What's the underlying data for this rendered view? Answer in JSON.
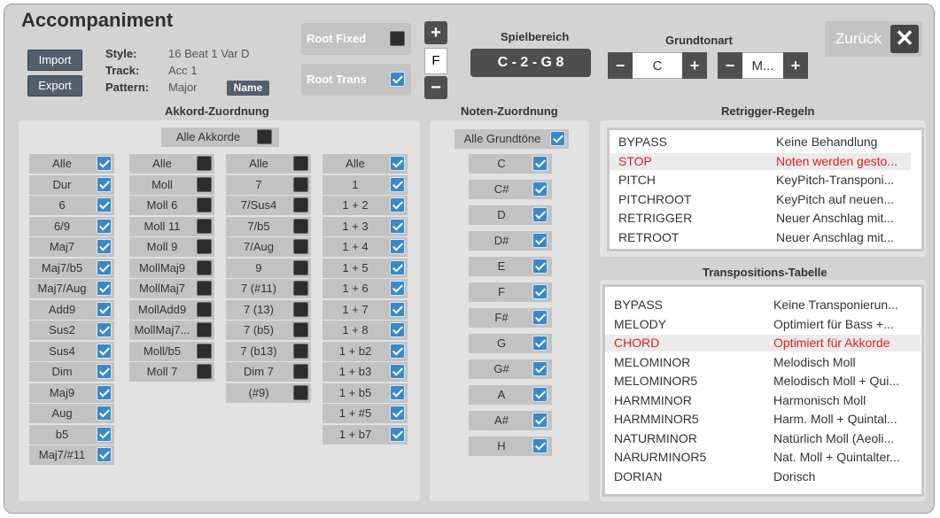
{
  "title": "Accompaniment",
  "buttons": {
    "import": "Import",
    "export": "Export",
    "name": "Name",
    "zurueck": "Zurück"
  },
  "info": {
    "style_label": "Style:",
    "style_value": "16 Beat 1 Var D",
    "track_label": "Track:",
    "track_value": "Acc 1",
    "pattern_label": "Pattern:",
    "pattern_value": "Major"
  },
  "root_fixed": {
    "label": "Root Fixed",
    "checked": false
  },
  "root_trans": {
    "label": "Root Trans",
    "checked": true
  },
  "octave": {
    "plus": "+",
    "value": "F",
    "minus": "−"
  },
  "spielbereich": {
    "title": "Spielbereich",
    "value": "C - 2 - G 8"
  },
  "grundtonart": {
    "title": "Grundtonart",
    "key_value": "C",
    "mode_value": "M..."
  },
  "akkord": {
    "title": "Akkord-Zuordnung",
    "all_label": "Alle Akkorde",
    "all_checked": false,
    "columns": [
      [
        {
          "l": "Alle",
          "c": true
        },
        {
          "l": "Dur",
          "c": true
        },
        {
          "l": "6",
          "c": true
        },
        {
          "l": "6/9",
          "c": true
        },
        {
          "l": "Maj7",
          "c": true
        },
        {
          "l": "Maj7/b5",
          "c": true
        },
        {
          "l": "Maj7/Aug",
          "c": true
        },
        {
          "l": "Add9",
          "c": true
        },
        {
          "l": "Sus2",
          "c": true
        },
        {
          "l": "Sus4",
          "c": true
        },
        {
          "l": "Dim",
          "c": true
        },
        {
          "l": "Maj9",
          "c": true
        },
        {
          "l": "Aug",
          "c": true
        },
        {
          "l": "b5",
          "c": true
        },
        {
          "l": "Maj7/#11",
          "c": true
        }
      ],
      [
        {
          "l": "Alle",
          "c": false
        },
        {
          "l": "Moll",
          "c": false
        },
        {
          "l": "Moll 6",
          "c": false
        },
        {
          "l": "Moll 11",
          "c": false
        },
        {
          "l": "Moll 9",
          "c": false
        },
        {
          "l": "MollMaj9",
          "c": false
        },
        {
          "l": "MollMaj7",
          "c": false
        },
        {
          "l": "MollAdd9",
          "c": false
        },
        {
          "l": "MollMaj7...",
          "c": false
        },
        {
          "l": "Moll/b5",
          "c": false
        },
        {
          "l": "Moll 7",
          "c": false
        }
      ],
      [
        {
          "l": "Alle",
          "c": false
        },
        {
          "l": "7",
          "c": false
        },
        {
          "l": "7/Sus4",
          "c": false
        },
        {
          "l": "7/b5",
          "c": false
        },
        {
          "l": "7/Aug",
          "c": false
        },
        {
          "l": "9",
          "c": false
        },
        {
          "l": "7 (#11)",
          "c": false
        },
        {
          "l": "7 (13)",
          "c": false
        },
        {
          "l": "7 (b5)",
          "c": false
        },
        {
          "l": "7 (b13)",
          "c": false
        },
        {
          "l": "Dim 7",
          "c": false
        },
        {
          "l": "(#9)",
          "c": false
        }
      ],
      [
        {
          "l": "Alle",
          "c": true
        },
        {
          "l": "1",
          "c": true
        },
        {
          "l": "1 + 2",
          "c": true
        },
        {
          "l": "1 + 3",
          "c": true
        },
        {
          "l": "1 + 4",
          "c": true
        },
        {
          "l": "1 + 5",
          "c": true
        },
        {
          "l": "1 + 6",
          "c": true
        },
        {
          "l": "1 + 7",
          "c": true
        },
        {
          "l": "1 + 8",
          "c": true
        },
        {
          "l": "1 + b2",
          "c": true
        },
        {
          "l": "1 + b3",
          "c": true
        },
        {
          "l": "1 + b5",
          "c": true
        },
        {
          "l": "1 + #5",
          "c": true
        },
        {
          "l": "1 + b7",
          "c": true
        }
      ]
    ]
  },
  "noten": {
    "title": "Noten-Zuordnung",
    "all_label": "Alle Grundtöne",
    "all_checked": true,
    "notes": [
      {
        "l": "C",
        "c": true
      },
      {
        "l": "C#",
        "c": true
      },
      {
        "l": "D",
        "c": true
      },
      {
        "l": "D#",
        "c": true
      },
      {
        "l": "E",
        "c": true
      },
      {
        "l": "F",
        "c": true
      },
      {
        "l": "F#",
        "c": true
      },
      {
        "l": "G",
        "c": true
      },
      {
        "l": "G#",
        "c": true
      },
      {
        "l": "A",
        "c": true
      },
      {
        "l": "A#",
        "c": true
      },
      {
        "l": "H",
        "c": true
      }
    ]
  },
  "retrigger": {
    "title": "Retrigger-Regeln",
    "rows": [
      {
        "name": "BYPASS",
        "desc": "Keine Behandlung",
        "selected": false
      },
      {
        "name": "STOP",
        "desc": "Noten werden gesto...",
        "selected": true
      },
      {
        "name": "PITCH",
        "desc": "KeyPitch-Transponi...",
        "selected": false
      },
      {
        "name": "PITCHROOT",
        "desc": "KeyPitch auf neuen...",
        "selected": false
      },
      {
        "name": "RETRIGGER",
        "desc": "Neuer Anschlag mit...",
        "selected": false
      },
      {
        "name": "RETROOT",
        "desc": "Neuer Anschlag mit...",
        "selected": false
      }
    ]
  },
  "transposition": {
    "title": "Transpositions-Tabelle",
    "rows": [
      {
        "name": "BYPASS",
        "desc": "Keine Transponierun...",
        "selected": false
      },
      {
        "name": "MELODY",
        "desc": "Optimiert für Bass +...",
        "selected": false
      },
      {
        "name": "CHORD",
        "desc": "Optimiert für Akkorde",
        "selected": true
      },
      {
        "name": "MELOMINOR",
        "desc": "Melodisch Moll",
        "selected": false
      },
      {
        "name": "MELOMINOR5",
        "desc": "Melodisch Moll + Qui...",
        "selected": false
      },
      {
        "name": "HARMMINOR",
        "desc": "Harmonisch Moll",
        "selected": false
      },
      {
        "name": "HARMMINOR5",
        "desc": " Harm. Moll + Quintal...",
        "selected": false
      },
      {
        "name": "NATURMINOR",
        "desc": "Natürlich Moll (Aeoli...",
        "selected": false
      },
      {
        "name": "NARURMINOR5",
        "desc": "Nat. Moll + Quintalter...",
        "selected": false
      },
      {
        "name": "DORIAN",
        "desc": "Dorisch",
        "selected": false
      }
    ]
  },
  "colors": {
    "window_bg": "#d3d3d3",
    "checkbox_on": "#3c88c7",
    "checkbox_off": "#2d2d2d",
    "selected_text": "#e02020",
    "button_bg": "#545f6e"
  }
}
